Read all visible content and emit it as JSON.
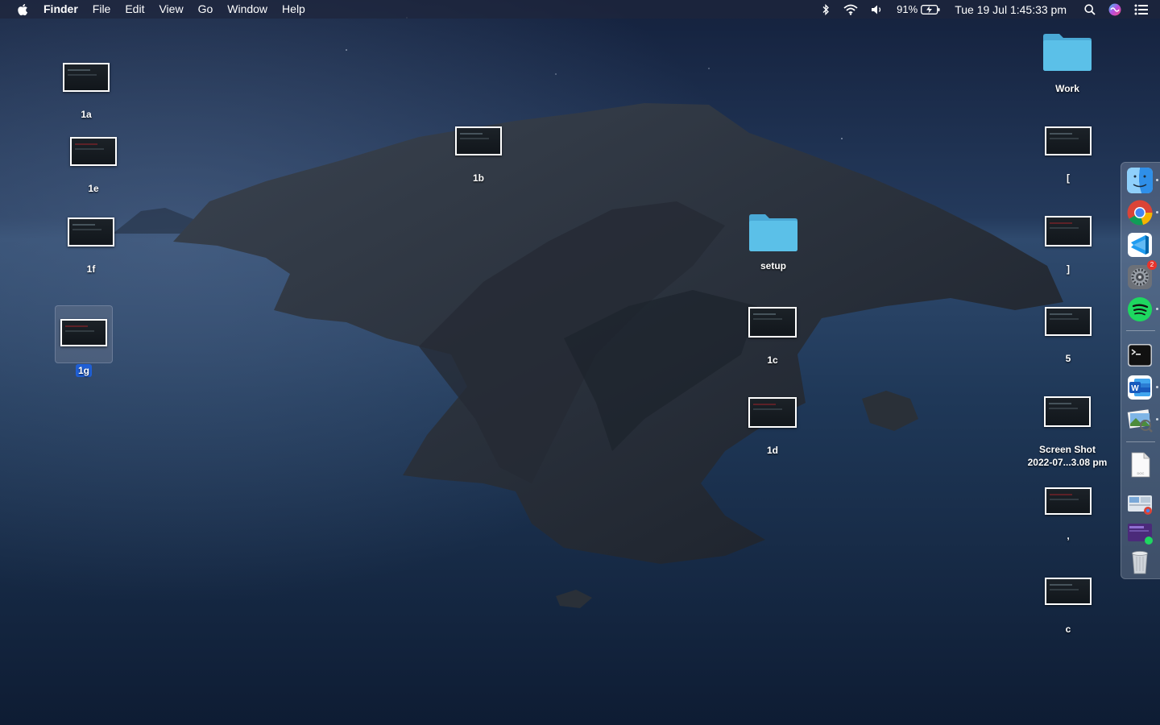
{
  "menubar": {
    "apple_icon": "apple-logo-icon",
    "app_name": "Finder",
    "items": [
      "File",
      "Edit",
      "View",
      "Go",
      "Window",
      "Help"
    ],
    "battery_percent": "91%",
    "clock": "Tue 19 Jul  1:45:33 pm",
    "status_icons": [
      "bluetooth-icon",
      "wifi-icon",
      "volume-icon",
      "battery-charging-icon",
      "spotlight-search-icon",
      "siri-icon",
      "control-center-icon"
    ]
  },
  "desktop": {
    "icons": {
      "i1a": "1a",
      "i1e": "1e",
      "i1f": "1f",
      "i1g": "1g",
      "i1b": "1b",
      "setup": "setup",
      "i1c": "1c",
      "i1d": "1d",
      "work": "Work",
      "bracket_open": "[",
      "bracket_close": "]",
      "five": "5",
      "screenshot": "Screen Shot\n2022-07...3.08 pm",
      "comma": ",",
      "c": "c"
    }
  },
  "dock": {
    "items": [
      "Finder",
      "Google Chrome",
      "Visual Studio Code",
      "System Preferences",
      "Spotify",
      "Terminal",
      "Microsoft Word",
      "Preview",
      "Document",
      "Recent Item 1",
      "Recent Item 2",
      "Trash"
    ],
    "system_prefs_badge": "2"
  },
  "colors": {
    "menubar_bg": "#1e263c",
    "selection_blue": "#1f5fd6",
    "folder_blue": "#5bc0e8"
  }
}
